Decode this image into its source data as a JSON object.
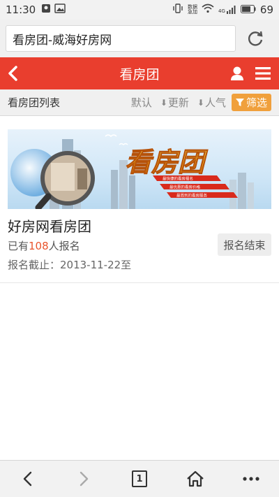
{
  "status_bar": {
    "time": "11:30",
    "network_top": "数据",
    "network_bottom": "急加",
    "signal_label": "4G",
    "battery": "69"
  },
  "browser": {
    "url_text": "看房团-威海好房网"
  },
  "header": {
    "title": "看房团"
  },
  "list_bar": {
    "title": "看房团列表",
    "sort_default": "默认",
    "sort_update": "更新",
    "sort_popular": "人气",
    "filter_label": "筛选"
  },
  "banner": {
    "logo_text": "看房团",
    "line1": "最快捷的看房报名",
    "line2": "最优惠的看房价格",
    "line3": "最周到的看房服务"
  },
  "card": {
    "title": "好房网看房团",
    "signup_prefix": "已有",
    "signup_count": "108",
    "signup_suffix": "人报名",
    "deadline": "报名截止：2013-11-22至",
    "status": "报名结束"
  },
  "bottom_nav": {
    "tab_count": "1"
  },
  "colors": {
    "header_red": "#e93e2e",
    "filter_orange": "#f0a03c",
    "count_red": "#e9542c"
  }
}
